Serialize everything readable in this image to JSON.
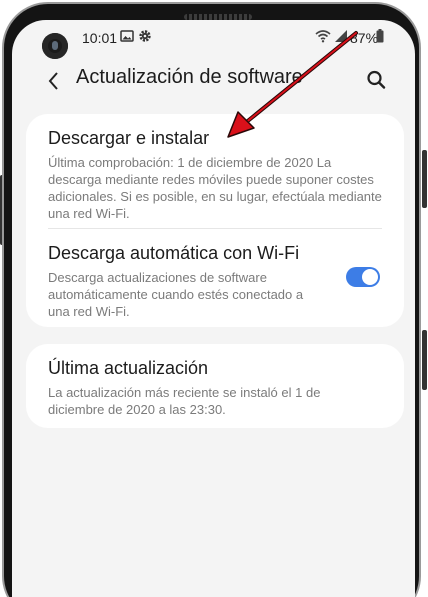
{
  "status_bar": {
    "time": "10:01",
    "battery": "87%"
  },
  "header": {
    "title": "Actualización de software"
  },
  "settings": {
    "download": {
      "title": "Descargar e instalar",
      "subtitle": "Última comprobación: 1 de diciembre de 2020 La descarga mediante redes móviles puede suponer costes adicionales. Si es posible, en su lugar, efectúala mediante una red Wi-Fi."
    },
    "auto_download": {
      "title": "Descarga automática con Wi-Fi",
      "subtitle": "Descarga actualizaciones de software automáticamente cuando estés conectado a una red Wi-Fi.",
      "enabled": true
    },
    "last_update": {
      "title": "Última actualización",
      "subtitle": "La actualización más reciente se instaló el 1 de diciembre de 2020 a las 23:30."
    }
  },
  "icons": {
    "status": [
      "image-icon",
      "gear-icon",
      "wifi-icon",
      "signal-icon",
      "battery-icon"
    ],
    "header": [
      "back-arrow-icon",
      "search-icon"
    ]
  },
  "colors": {
    "accent": "#3d7de6",
    "annotation_arrow": "#d9101a",
    "card_background": "#ffffff",
    "screen_background": "#f4f4f4"
  }
}
